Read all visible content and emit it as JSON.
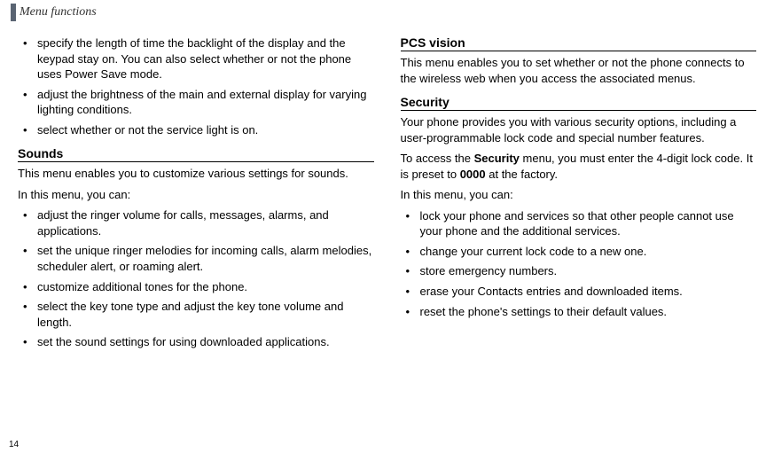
{
  "header": "Menu functions",
  "pageNumber": "14",
  "leftColumn": {
    "introBullets": [
      "specify the length of time the backlight of the display and the keypad stay on. You can also select whether or not the phone uses Power Save mode.",
      "adjust the brightness of the main and external display for varying lighting conditions.",
      "select whether or not the service light is on."
    ],
    "sounds": {
      "title": "Sounds",
      "desc": "This menu enables you to customize various settings for sounds.",
      "intro": "In this menu, you can:",
      "bullets": [
        "adjust the ringer volume for calls, messages, alarms, and applications.",
        "set the unique ringer melodies for incoming calls, alarm melodies, scheduler alert, or roaming alert.",
        "customize additional tones for the phone.",
        "select the key tone type and adjust the key tone volume and length.",
        "set the sound settings for using downloaded applications."
      ]
    }
  },
  "rightColumn": {
    "pcs": {
      "title": "PCS vision",
      "desc": "This menu enables you to set whether or not the phone connects to the wireless web when you access the associated menus."
    },
    "security": {
      "title": "Security",
      "desc": "Your phone provides you with various security options, including a user-programmable lock code and special number features.",
      "access_prefix": "To access the ",
      "access_bold": "Security",
      "access_mid": " menu, you must enter the 4-digit lock code. It is preset to ",
      "access_code": "0000",
      "access_suffix": " at the factory.",
      "intro": "In this menu, you can:",
      "bullets": [
        "lock your phone and services so that other people cannot use your phone and the additional services.",
        "change your current lock code to a new one.",
        "store emergency numbers.",
        "erase your Contacts entries and downloaded items.",
        "reset the phone's settings to their default values."
      ]
    }
  }
}
